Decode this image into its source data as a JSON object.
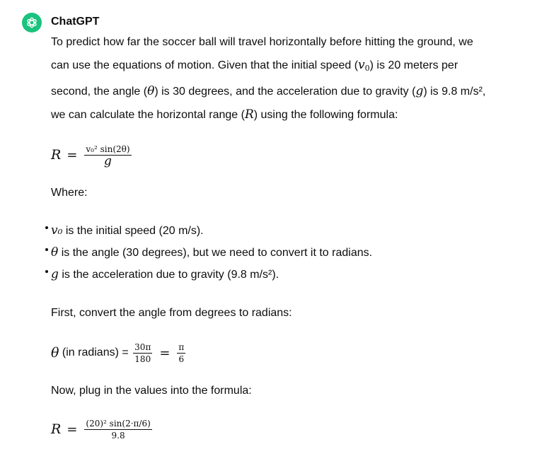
{
  "message": {
    "author": "ChatGPT",
    "avatar_icon": "openai-logo-icon",
    "avatar_color": "#19c37d",
    "intro": {
      "t1": "To predict how far the soccer ball will travel horizontally before hitting the ground, we",
      "t2": "can use the equations of motion. Given that the initial speed (",
      "t3": ") is 20 meters per",
      "t4": "second, the angle (",
      "t5": ") is 30 degrees, and the acceleration due to gravity (",
      "t6": ") is 9.8 m/s²,",
      "t7": "we can calculate the horizontal range (",
      "t8": ") using the following formula:"
    },
    "formula1": {
      "lhs": "R",
      "equals": "=",
      "numerator": "v₀² sin(2θ)",
      "denominator": "g"
    },
    "where_label": "Where:",
    "bullets": [
      {
        "symbol": "v₀",
        "text": " is the initial speed (20 m/s)."
      },
      {
        "symbol": "θ",
        "text": " is the angle (30 degrees), but we need to convert it to radians."
      },
      {
        "symbol": "g",
        "text": " is the acceleration due to gravity (9.8 m/s²)."
      }
    ],
    "convert_label": "First, convert the angle from degrees to radians:",
    "formula2": {
      "lhs_symbol": "θ",
      "lhs_text": " (in radians) = ",
      "frac1_num": "30π",
      "frac1_den": "180",
      "equals": "=",
      "frac2_num": "π",
      "frac2_den": "6"
    },
    "plug_label": "Now, plug in the values into the formula:",
    "formula3": {
      "lhs": "R",
      "equals": "=",
      "numerator": "(20)² sin(2·π/6)",
      "denominator": "9.8"
    },
    "symbols": {
      "v": "v",
      "v_sub": "0",
      "theta": "θ",
      "g": "g",
      "R": "R"
    }
  }
}
